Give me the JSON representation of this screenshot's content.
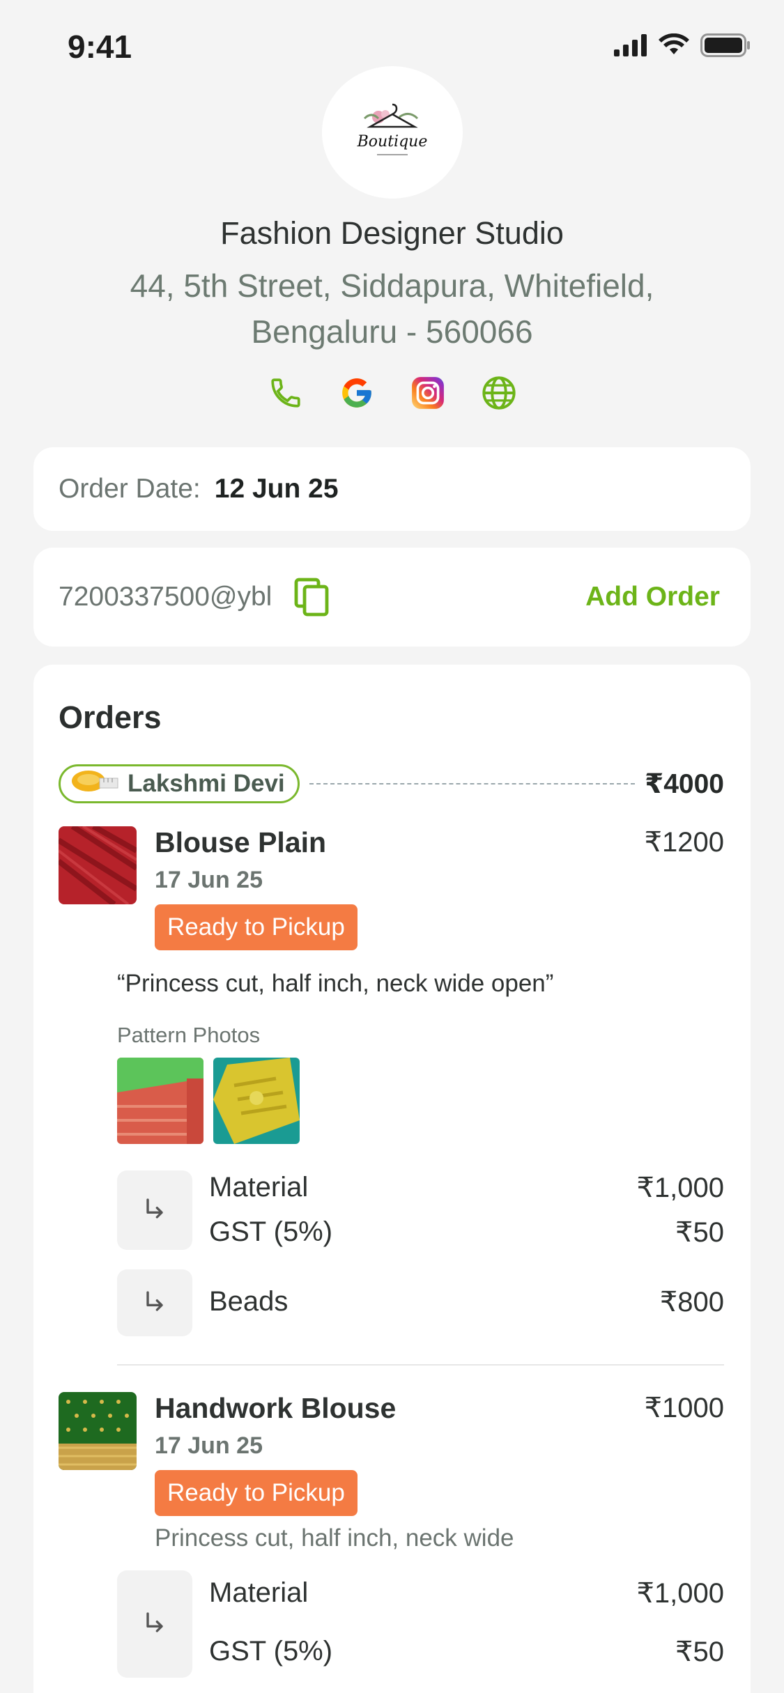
{
  "status_bar": {
    "time": "9:41"
  },
  "shop": {
    "logo_text": "Boutique",
    "name": "Fashion Designer Studio",
    "address_line1": "44, 5th Street, Siddapura, Whitefield,",
    "address_line2": "Bengaluru - 560066",
    "social_icons": [
      "phone-icon",
      "google-icon",
      "instagram-icon",
      "globe-icon"
    ]
  },
  "order_date": {
    "label": "Order Date:",
    "value": "12 Jun 25"
  },
  "payment": {
    "upi": "7200337500@ybl",
    "add_order_label": "Add Order"
  },
  "orders": {
    "title": "Orders",
    "customer": {
      "name": "Lakshmi Devi",
      "total": "₹4000"
    },
    "items": [
      {
        "name": "Blouse Plain",
        "price": "₹1200",
        "date": "17 Jun 25",
        "status": "Ready to Pickup",
        "note": "“Princess cut, half inch, neck wide open”",
        "pattern_label": "Pattern Photos",
        "extras": [
          {
            "rows": [
              {
                "label": "Material",
                "amount": "₹1,000"
              },
              {
                "label": "GST (5%)",
                "amount": "₹50"
              }
            ]
          },
          {
            "rows": [
              {
                "label": "Beads",
                "amount": "₹800"
              }
            ]
          }
        ]
      },
      {
        "name": "Handwork Blouse",
        "price": "₹1000",
        "date": "17 Jun 25",
        "status": "Ready to Pickup",
        "note": "Princess cut, half inch, neck wide",
        "extras": [
          {
            "rows": [
              {
                "label": "Material",
                "amount": "₹1,000"
              },
              {
                "label": "GST (5%)",
                "amount": "₹50"
              }
            ]
          }
        ]
      }
    ]
  },
  "colors": {
    "accent_green": "#6cb418",
    "status_orange": "#f47b43",
    "muted_text": "#6b7470"
  }
}
